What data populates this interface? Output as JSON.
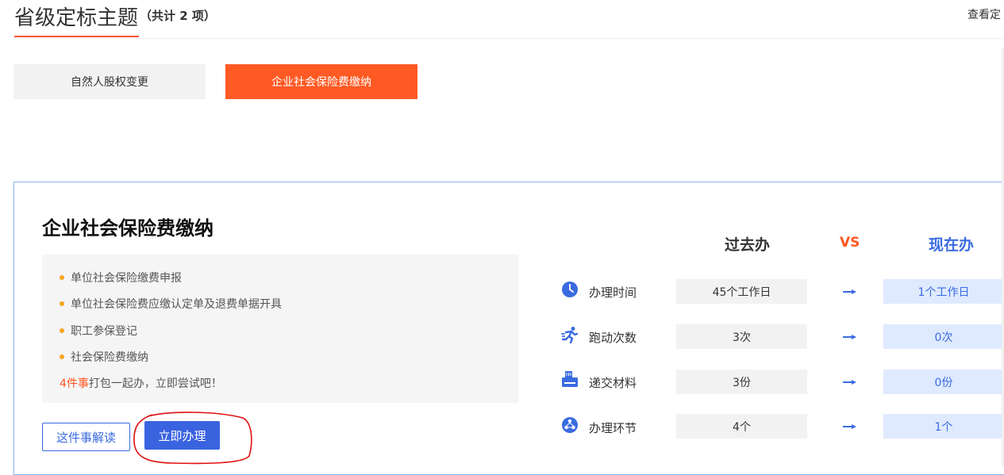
{
  "header": {
    "title": "省级定标主题",
    "count": "（共计 2 项）",
    "view_link": "查看定"
  },
  "tabs": [
    {
      "label": "自然人股权变更",
      "active": false
    },
    {
      "label": "企业社会保险费缴纳",
      "active": true
    }
  ],
  "card": {
    "title": "企业社会保险费缴纳",
    "items": [
      "单位社会保险缴费申报",
      "单位社会保险费应缴认定单及退费单据开具",
      "职工参保登记",
      "社会保险费缴纳"
    ],
    "summary_count": "4件事",
    "summary_text": "打包一起办，立即尝试吧！",
    "btn_interpret": "这件事解读",
    "btn_apply": "立即办理"
  },
  "comparison": {
    "head_past": "过去办",
    "head_vs": "VS",
    "head_now": "现在办",
    "rows": [
      {
        "icon": "clock-icon",
        "label": "办理时间",
        "past": "45个工作日",
        "now": "1个工作日"
      },
      {
        "icon": "running-icon",
        "label": "跑动次数",
        "past": "3次",
        "now": "0次"
      },
      {
        "icon": "printer-icon",
        "label": "递交材料",
        "past": "3份",
        "now": "0份"
      },
      {
        "icon": "process-icon",
        "label": "办理环节",
        "past": "4个",
        "now": "1个"
      }
    ]
  },
  "colors": {
    "accent_orange": "#ff5722",
    "primary_blue": "#3a6be0",
    "now_bg": "#dfeaff",
    "annotation_red": "#e01010"
  }
}
